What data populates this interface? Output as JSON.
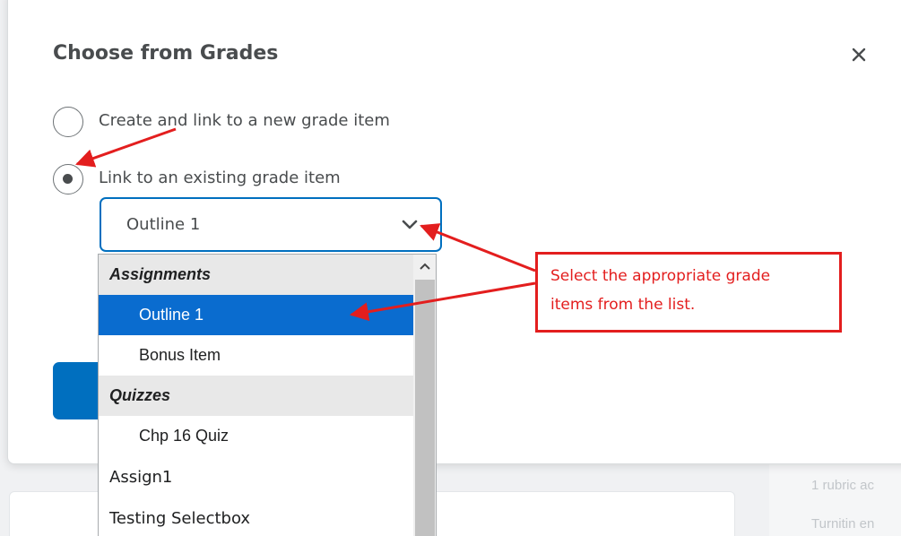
{
  "background": {
    "top_right_text": "·  ·  ·  ·",
    "right_lines": [
      "1 rubric ac",
      "Turnitin en"
    ]
  },
  "dialog": {
    "title": "Choose from Grades",
    "close_icon": "close-icon",
    "options": [
      {
        "label": "Create and link to a new grade item",
        "checked": false
      },
      {
        "label": "Link to an existing grade item",
        "checked": true
      }
    ],
    "select": {
      "value": "Outline 1",
      "icon": "chevron-down-icon"
    },
    "listbox": {
      "items": [
        {
          "type": "group",
          "label": "Assignments"
        },
        {
          "type": "child",
          "label": "Outline 1",
          "selected": true
        },
        {
          "type": "child",
          "label": "Bonus Item"
        },
        {
          "type": "group",
          "label": "Quizzes"
        },
        {
          "type": "child",
          "label": "Chp 16 Quiz"
        },
        {
          "type": "top",
          "label": "Assign1"
        },
        {
          "type": "top",
          "label": "Testing Selectbox"
        }
      ]
    },
    "primary_color": "#006fbf"
  },
  "annotation": {
    "lines": [
      "Select the appropriate grade",
      "items from the list."
    ],
    "color": "#e31e1e"
  }
}
